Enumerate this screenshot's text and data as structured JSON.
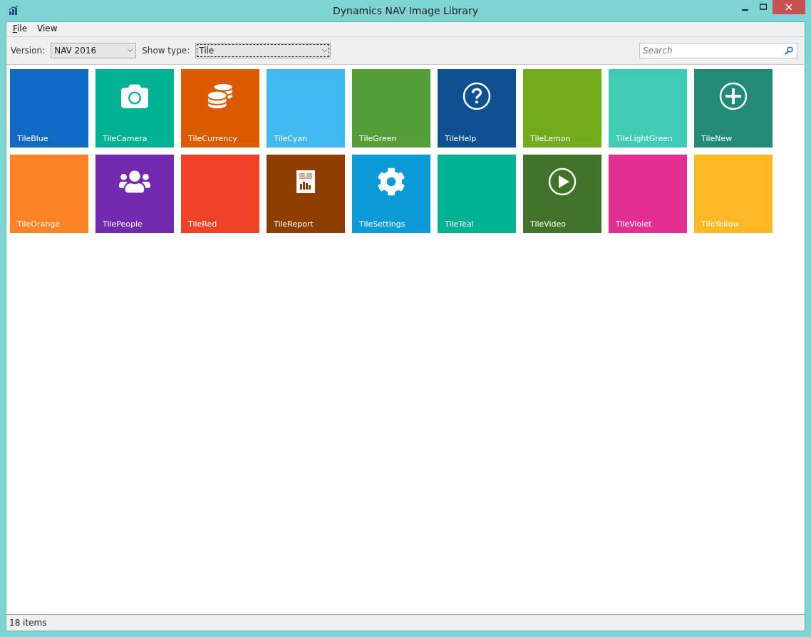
{
  "window": {
    "title": "Dynamics NAV Image Library"
  },
  "menu": [
    {
      "label": "File"
    },
    {
      "label": "View"
    }
  ],
  "toolbar": {
    "version": {
      "label": "Version:",
      "value": "NAV 2016"
    },
    "show_type": {
      "label": "Show type:",
      "value": "Tile",
      "focused": true
    },
    "search": {
      "placeholder": "Search"
    }
  },
  "tiles": [
    {
      "label": "TileBlue",
      "color": "#106ac4",
      "kind": "plain"
    },
    {
      "label": "TileCamera",
      "color": "#00b294",
      "kind": "camera"
    },
    {
      "label": "TileCurrency",
      "color": "#da5b00",
      "kind": "coins"
    },
    {
      "label": "TileCyan",
      "color": "#3fb9f0",
      "kind": "plain"
    },
    {
      "label": "TileGreen",
      "color": "#549e38",
      "kind": "plain"
    },
    {
      "label": "TileHelp",
      "color": "#0e5193",
      "kind": "help"
    },
    {
      "label": "TileLemon",
      "color": "#70ac1c",
      "kind": "plain"
    },
    {
      "label": "TileLightGreen",
      "color": "#40ccb4",
      "kind": "plain"
    },
    {
      "label": "TileNew",
      "color": "#218b78",
      "kind": "plus"
    },
    {
      "label": "TileOrange",
      "color": "#fd8326",
      "kind": "plain"
    },
    {
      "label": "TilePeople",
      "color": "#732ab1",
      "kind": "people"
    },
    {
      "label": "TileRed",
      "color": "#ee4126",
      "kind": "plain"
    },
    {
      "label": "TileReport",
      "color": "#8e3e00",
      "kind": "report"
    },
    {
      "label": "TileSettings",
      "color": "#0d9bd8",
      "kind": "gear"
    },
    {
      "label": "TileTeal",
      "color": "#00b294",
      "kind": "plain"
    },
    {
      "label": "TileVideo",
      "color": "#41742a",
      "kind": "play"
    },
    {
      "label": "TileViolet",
      "color": "#e22e91",
      "kind": "plain"
    },
    {
      "label": "TileYellow",
      "color": "#fdb823",
      "kind": "plain"
    }
  ],
  "status_bar": {
    "text": "18 items"
  }
}
